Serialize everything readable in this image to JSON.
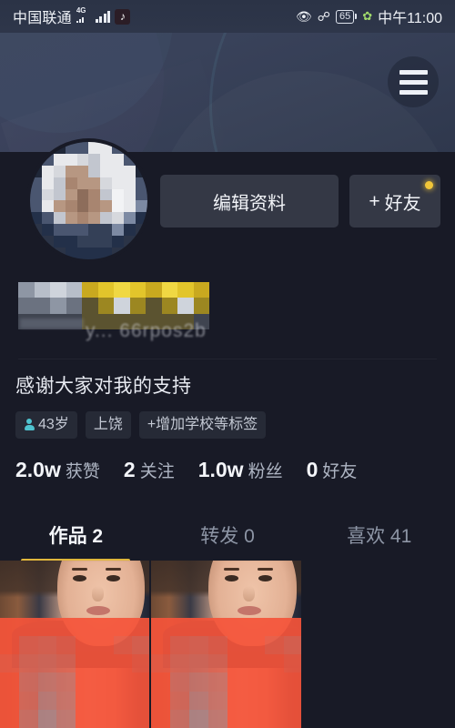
{
  "statusbar": {
    "carrier": "中国联通",
    "network_label": "4G",
    "app_badge_icon": "tiktok-note-icon",
    "eye_icon": "eye-protect-icon",
    "bluetooth_icon": "bluetooth-icon",
    "battery_level": "65",
    "eco_icon": "power-saving-leaf-icon",
    "clock": "中午11:00"
  },
  "header": {
    "menu_icon": "hamburger-menu-icon"
  },
  "profile": {
    "avatar_alt": "user-avatar",
    "name_redacted": "y... 66rpos2b",
    "bio": "感谢大家对我的支持",
    "tags": [
      {
        "icon": "person-icon",
        "label": "43岁"
      },
      {
        "icon": "",
        "label": "上饶"
      },
      {
        "icon": "",
        "label": "+增加学校等标签"
      }
    ]
  },
  "actions": {
    "edit_label": "编辑资料",
    "friend_label": "好友",
    "friend_plus": "+",
    "friend_badge": "new-notification-dot"
  },
  "stats": [
    {
      "num": "2.0w",
      "label": "获赞"
    },
    {
      "num": "2",
      "label": "关注"
    },
    {
      "num": "1.0w",
      "label": "粉丝"
    },
    {
      "num": "0",
      "label": "好友"
    }
  ],
  "tabs": [
    {
      "label": "作品 2",
      "active": true
    },
    {
      "label": "转发 0",
      "active": false
    },
    {
      "label": "喜欢 41",
      "active": false
    }
  ],
  "colors": {
    "accent_yellow": "#e0b73c",
    "background": "#181a26",
    "banner": "#39425a",
    "button": "#343845",
    "overlay_red": "#f5543a",
    "tag_icon_cyan": "#4fc3cf"
  },
  "grid": {
    "items": [
      {
        "name": "video-thumbnail-1",
        "filled": true
      },
      {
        "name": "video-thumbnail-2",
        "filled": true
      },
      {
        "name": "video-slot-empty",
        "filled": false
      }
    ]
  }
}
